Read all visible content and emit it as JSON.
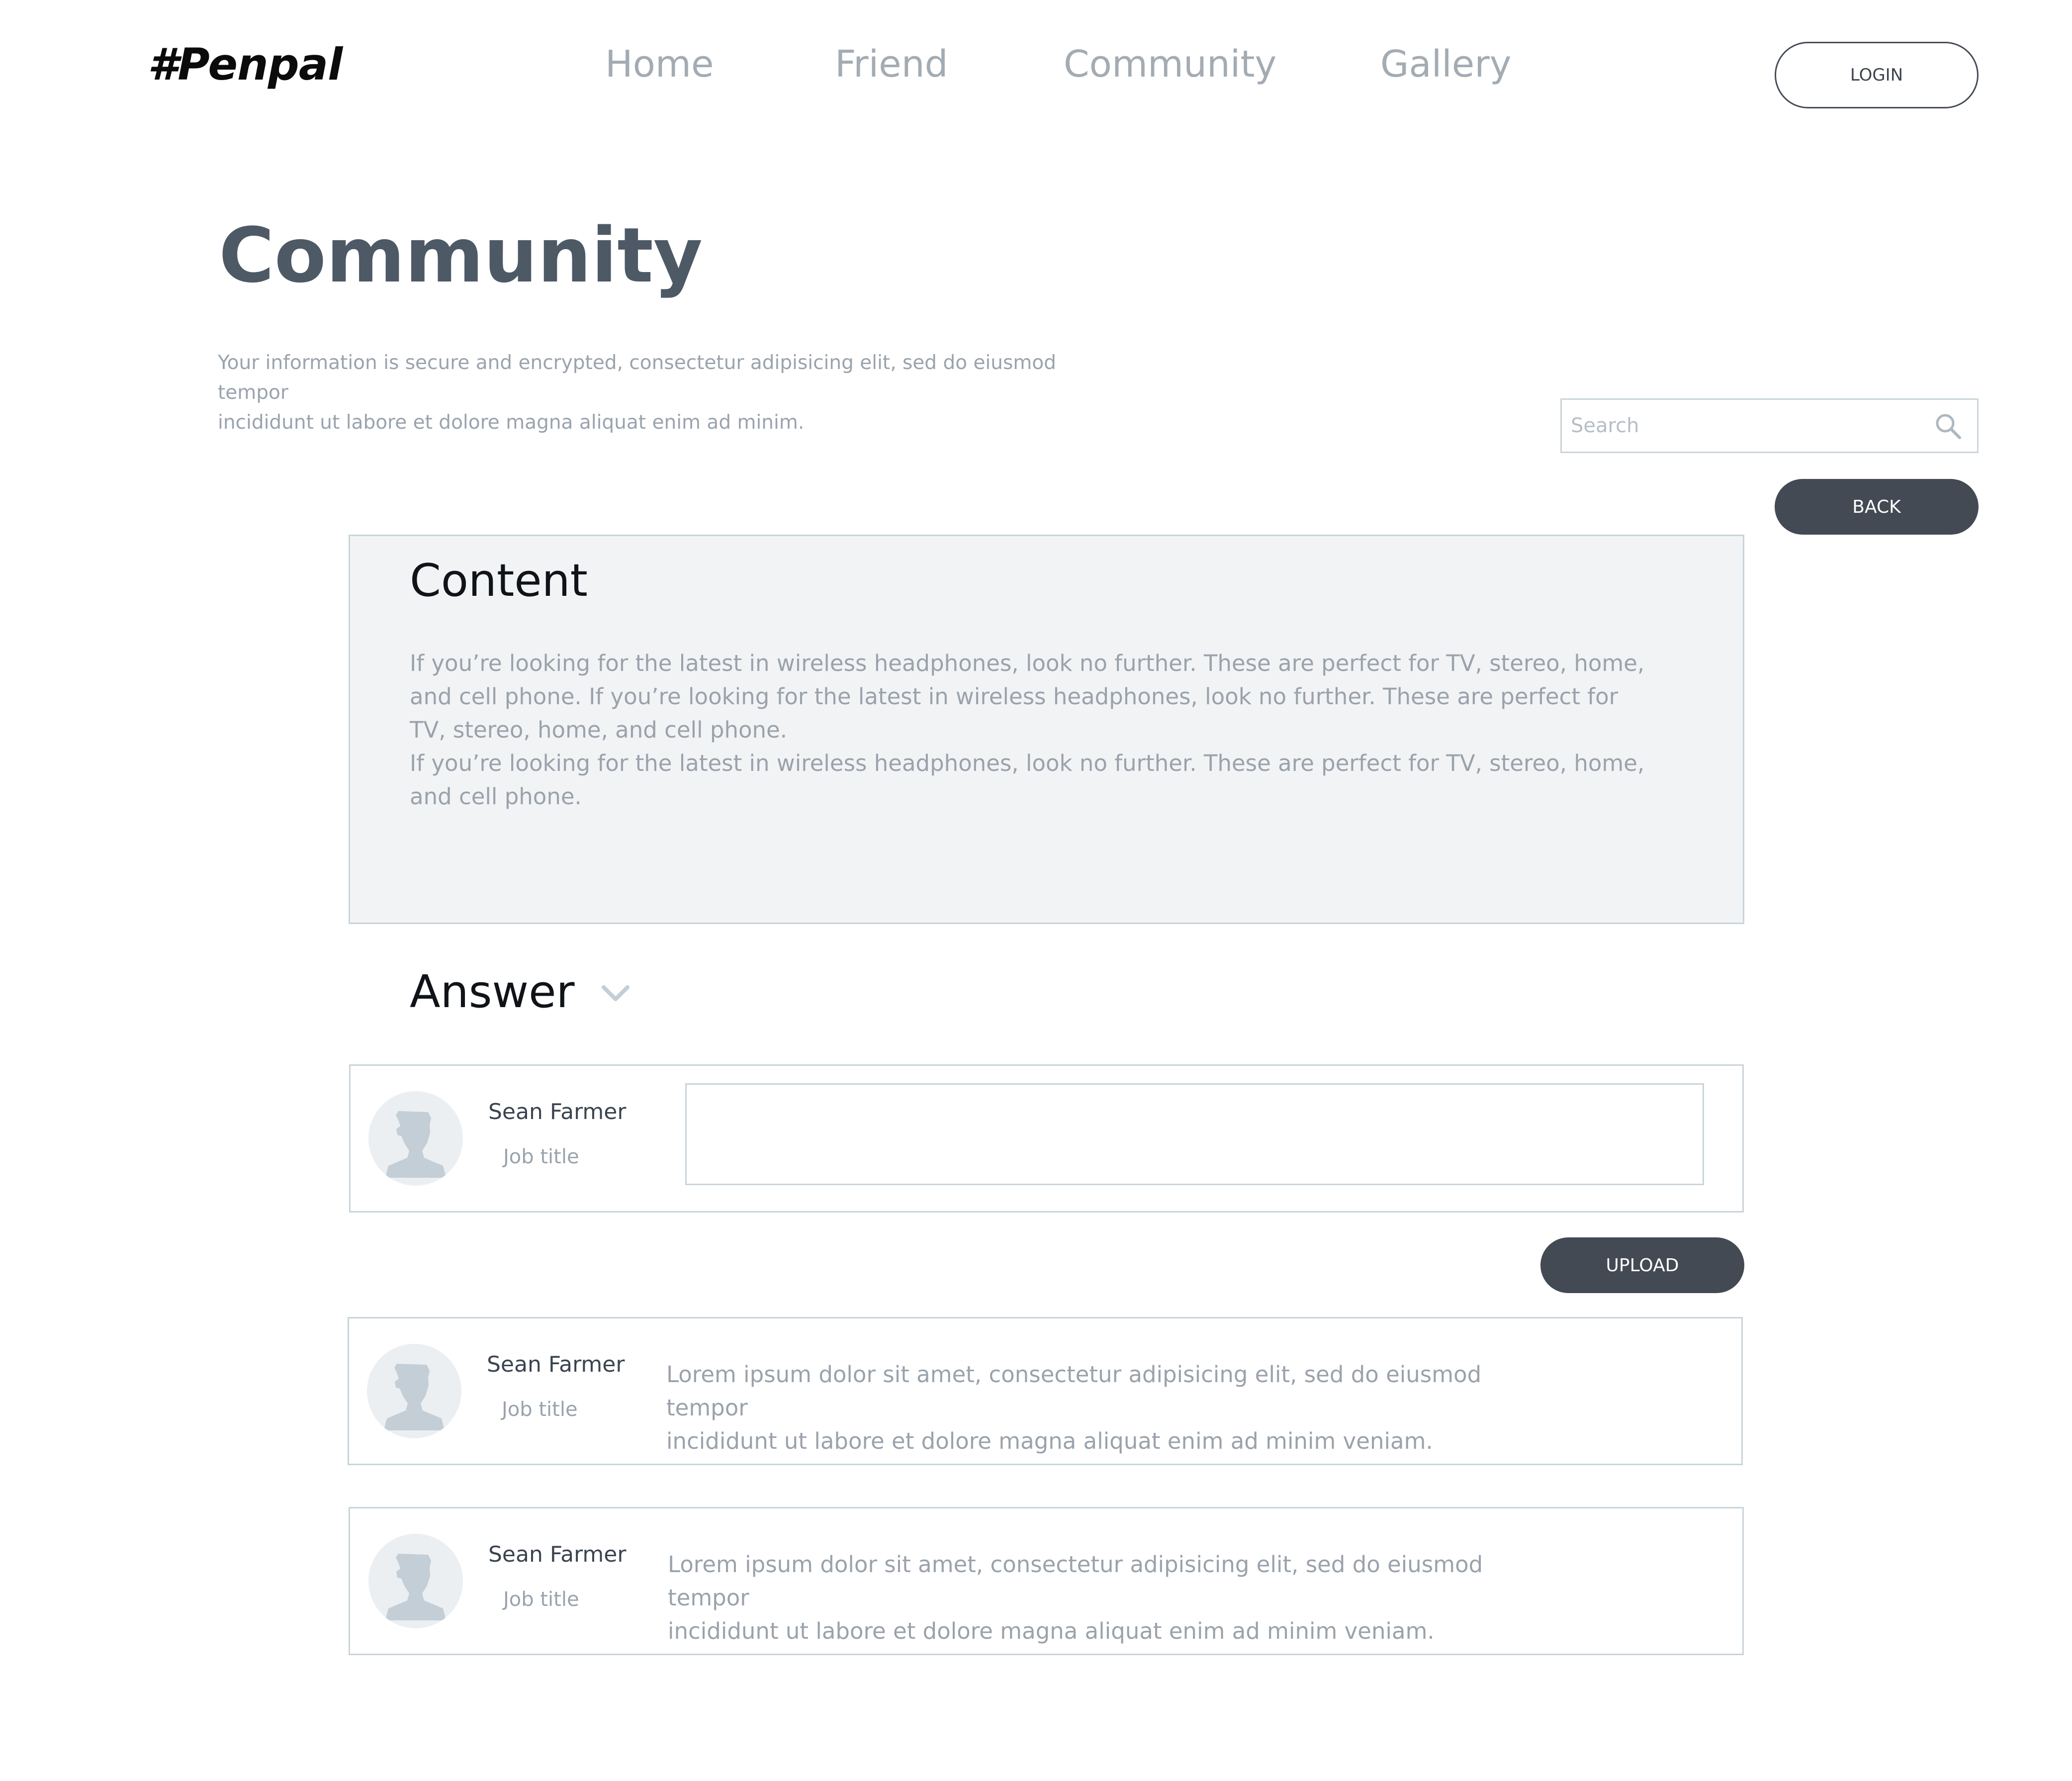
{
  "header": {
    "logo": "#Penpal",
    "nav": [
      "Home",
      "Friend",
      "Community",
      "Gallery"
    ],
    "login_label": "LOGIN"
  },
  "page": {
    "title": "Community",
    "subtitle_line1": "Your information is secure and encrypted, consectetur adipisicing elit, sed do eiusmod tempor",
    "subtitle_line2": "incididunt ut labore et dolore magna aliquat enim ad minim."
  },
  "search": {
    "placeholder": "Search",
    "icon": "search-icon"
  },
  "back_label": "BACK",
  "content": {
    "heading": "Content",
    "body": "If you’re looking for the latest in wireless headphones, look no further. These are perfect for TV, stereo, home, and cell phone. If you’re looking for the latest in wireless headphones, look no further. These are perfect for TV, stereo, home, and cell phone.\n If you’re looking for the latest in wireless headphones, look no further. These are perfect for TV, stereo, home, and cell phone."
  },
  "answer": {
    "heading": "Answer",
    "composer": {
      "name": "Sean Farmer",
      "job": "Job title",
      "value": ""
    },
    "upload_label": "UPLOAD"
  },
  "comments": [
    {
      "name": "Sean Farmer",
      "job": "Job title",
      "text_line1": "Lorem ipsum dolor sit amet, consectetur adipisicing elit, sed do eiusmod tempor",
      "text_line2": "incididunt ut labore et dolore magna aliquat enim ad minim veniam."
    },
    {
      "name": "Sean Farmer",
      "job": "Job title",
      "text_line1": "Lorem ipsum dolor sit amet, consectetur adipisicing elit, sed do eiusmod tempor",
      "text_line2": "incididunt ut labore et dolore magna aliquat enim ad minim veniam."
    }
  ],
  "colors": {
    "text_dark": "#4e5966",
    "text_muted": "#9aa3ad",
    "button_dark": "#434a54",
    "border": "#c9d4da",
    "card_bg": "#f2f3f5",
    "avatar_fill": "#c3ced6"
  }
}
